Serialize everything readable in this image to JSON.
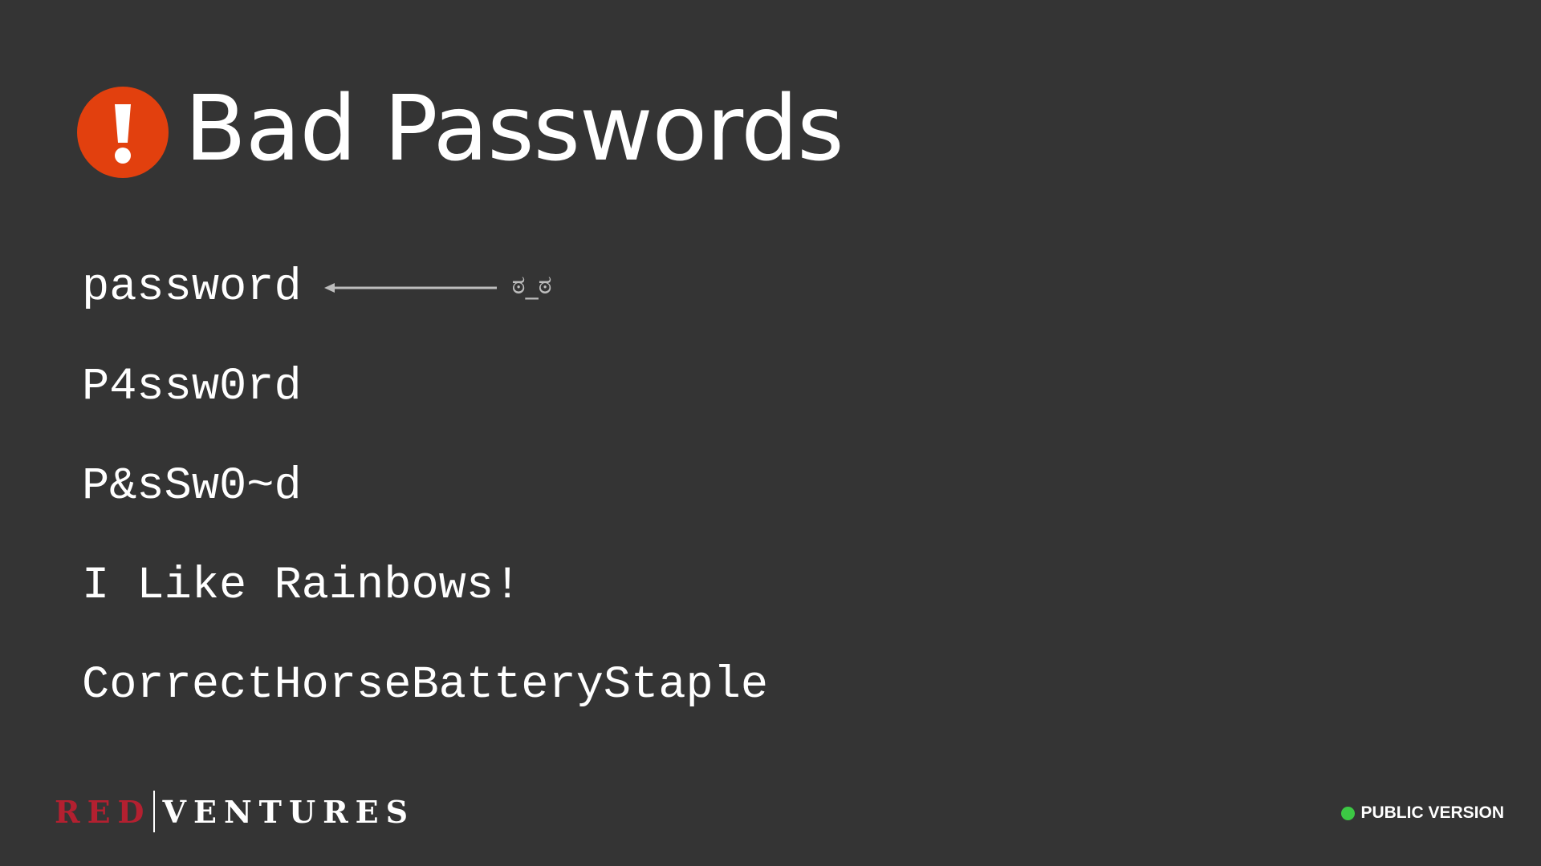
{
  "slide": {
    "title": "Bad Passwords",
    "title_icon": "exclamation-circle-icon",
    "alert_color": "#e2400e",
    "background_color": "#343434"
  },
  "passwords": [
    {
      "text": "password"
    },
    {
      "text": "P4ssw0rd"
    },
    {
      "text": "P&sSw0~d"
    },
    {
      "text": "I Like Rainbows!"
    },
    {
      "text": "CorrectHorseBatteryStaple"
    }
  ],
  "annotation": {
    "icon": "left-arrow-icon",
    "face": "ಠ_ಠ"
  },
  "footer": {
    "brand_red": "RED",
    "brand_ventures": "VENTURES",
    "brand_red_color": "#b32030",
    "badge_label": "PUBLIC VERSION",
    "badge_dot_color": "#3cc844"
  }
}
